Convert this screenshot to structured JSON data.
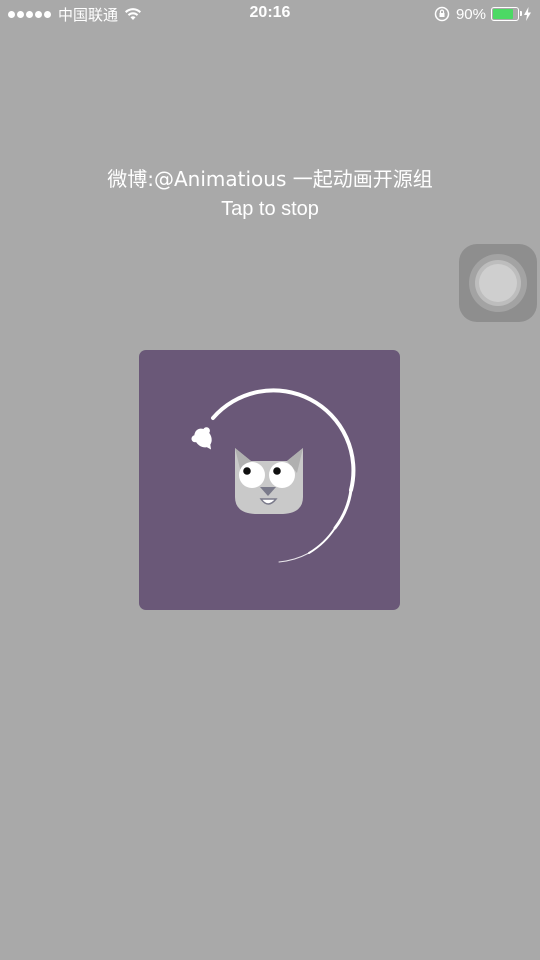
{
  "status_bar": {
    "carrier": "中国联通",
    "time": "20:16",
    "battery_percent": "90%",
    "battery_level": 0.9,
    "icons": [
      "signal-dots-icon",
      "wifi-icon",
      "rotation-lock-icon",
      "battery-icon",
      "charging-bolt-icon"
    ]
  },
  "header": {
    "line1": "微博:@Animatious 一起动画开源组",
    "line2": "Tap to stop"
  },
  "animation": {
    "subject": "cat-face-icon",
    "toy": "mouse-icon",
    "colors": {
      "card_background": "#6a5878",
      "stroke": "#ffffff",
      "cat_face": "#c9c9c9",
      "cat_face_shadow": "#b0b0b0"
    }
  },
  "colors": {
    "background": "#a9a9a9",
    "text": "#ffffff",
    "battery_fill": "#4cd964"
  }
}
